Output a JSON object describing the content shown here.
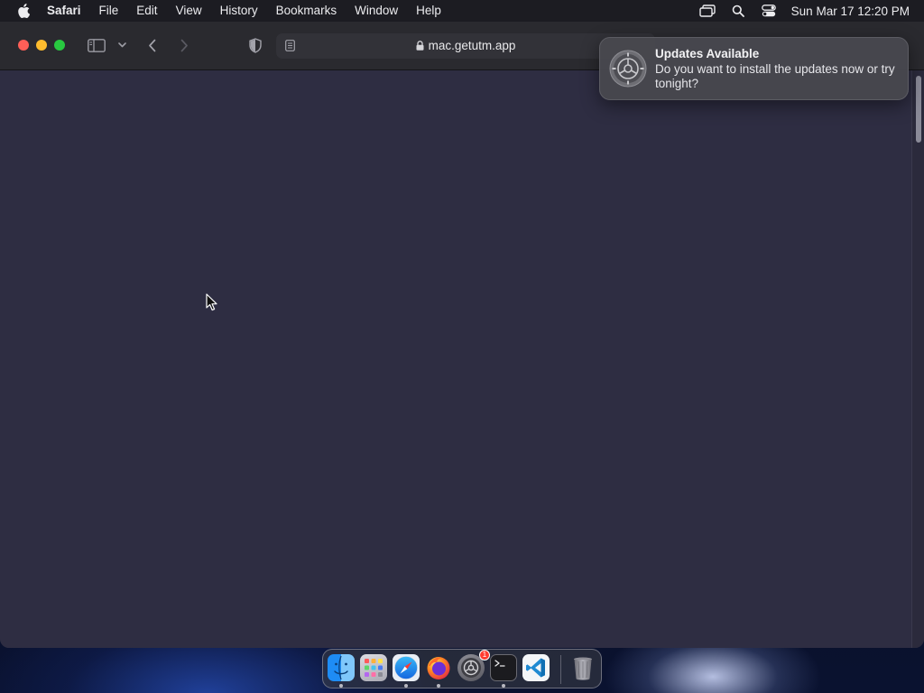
{
  "menubar": {
    "apple_icon": "apple-logo-icon",
    "app_name": "Safari",
    "items": [
      "File",
      "Edit",
      "View",
      "History",
      "Bookmarks",
      "Window",
      "Help"
    ],
    "status_icons": [
      "screen-mirroring-icon",
      "spotlight-search-icon",
      "control-center-icon"
    ],
    "clock": "Sun Mar 17  12:20 PM"
  },
  "browser": {
    "url": "mac.getutm.app",
    "content_background": "#2e2d42"
  },
  "notification": {
    "icon": "system-settings-gear-icon",
    "title": "Updates Available",
    "body": "Do you want to install the updates now or try tonight?"
  },
  "dock": {
    "apps": [
      {
        "name": "Finder",
        "icon": "finder-icon",
        "running": true
      },
      {
        "name": "Launchpad",
        "icon": "launchpad-icon",
        "running": false
      },
      {
        "name": "Safari",
        "icon": "safari-icon",
        "running": true
      },
      {
        "name": "Firefox",
        "icon": "firefox-icon",
        "running": true
      },
      {
        "name": "System Settings",
        "icon": "system-settings-icon",
        "running": false,
        "badge": "1"
      },
      {
        "name": "Terminal",
        "icon": "terminal-icon",
        "running": true
      },
      {
        "name": "Visual Studio Code",
        "icon": "vscode-icon",
        "running": false
      },
      {
        "name": "Trash",
        "icon": "trash-icon",
        "running": false
      }
    ]
  },
  "colors": {
    "close": "#fe5f57",
    "minimize": "#febc2e",
    "zoom": "#28c840",
    "badge": "#ff3b30"
  }
}
